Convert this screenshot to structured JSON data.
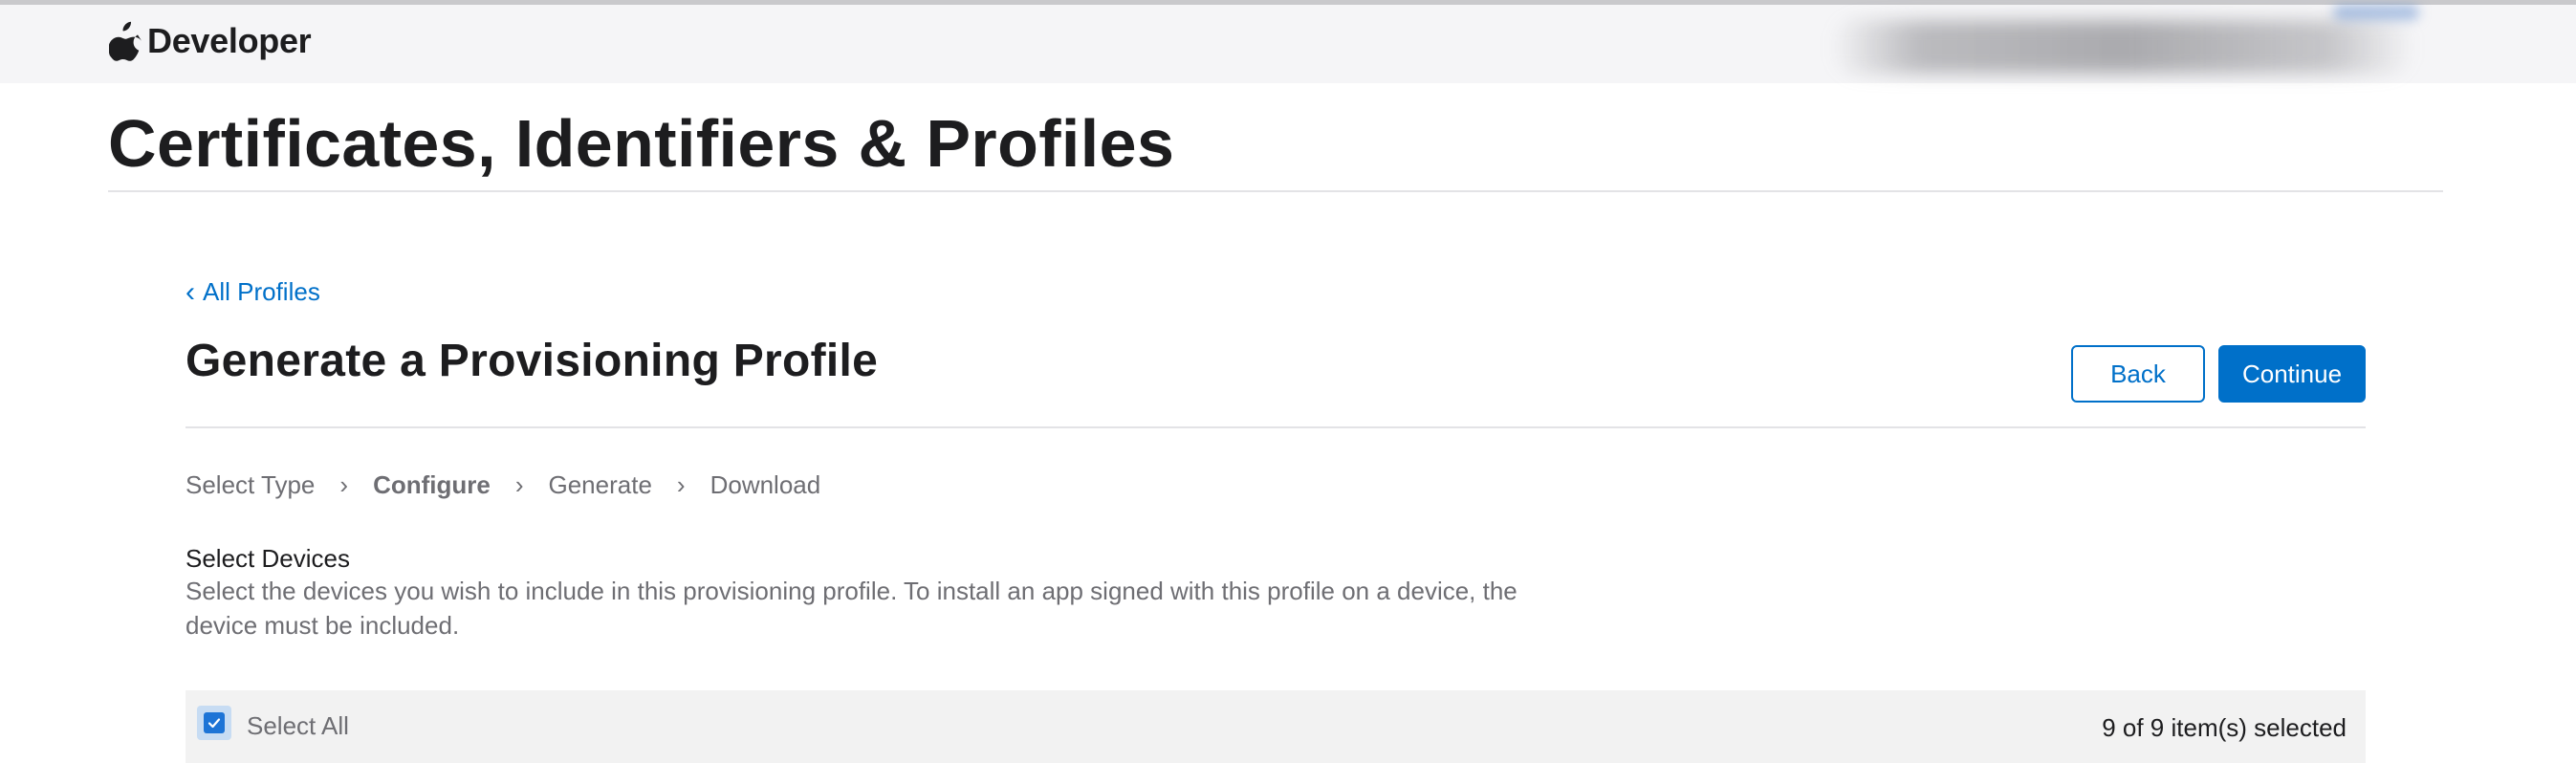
{
  "nav": {
    "brand": "Developer"
  },
  "page": {
    "title": "Certificates, Identifiers & Profiles"
  },
  "breadcrumb": {
    "back_label": "All Profiles"
  },
  "section": {
    "title": "Generate a Provisioning Profile",
    "back_button": "Back",
    "continue_button": "Continue"
  },
  "steps": [
    {
      "label": "Select Type",
      "current": false
    },
    {
      "label": "Configure",
      "current": true
    },
    {
      "label": "Generate",
      "current": false
    },
    {
      "label": "Download",
      "current": false
    }
  ],
  "devices": {
    "heading": "Select Devices",
    "description": "Select the devices you wish to include in this provisioning profile. To install an app signed with this profile on a device, the device must be included.",
    "select_all_label": "Select All",
    "select_all_checked": true,
    "selected_count_text": "9 of 9 item(s) selected"
  },
  "colors": {
    "accent": "#0070c9",
    "nav_background": "#f5f5f7",
    "row_background": "#f2f2f2"
  },
  "icons": {
    "brand": "apple-logo-icon",
    "back": "chevron-left-icon",
    "step_separator": "chevron-right-icon",
    "checkbox": "checkmark-icon"
  }
}
